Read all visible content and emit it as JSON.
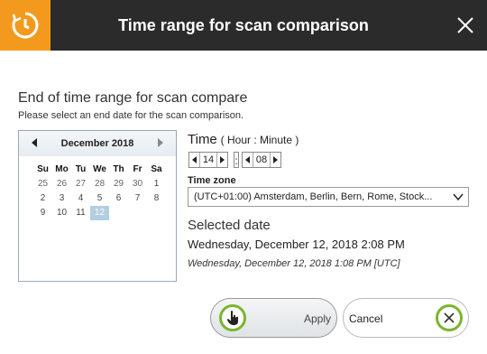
{
  "titlebar": {
    "title": "Time range for scan comparison",
    "accent_color": "#f39a1e",
    "bar_color": "#2b2b2b"
  },
  "content": {
    "heading": "End of time range for scan compare",
    "subheading": "Please select an end date for the scan comparison."
  },
  "calendar": {
    "month_label": "December 2018",
    "weekdays": [
      "Su",
      "Mo",
      "Tu",
      "We",
      "Th",
      "Fr",
      "Sa"
    ],
    "rows": [
      [
        "25",
        "26",
        "27",
        "28",
        "29",
        "30",
        "1"
      ],
      [
        "2",
        "3",
        "4",
        "5",
        "6",
        "7",
        "8"
      ],
      [
        "9",
        "10",
        "11",
        "12",
        "",
        "",
        ""
      ]
    ],
    "selected_day": "12",
    "selected_color": "#b2cfe0"
  },
  "time": {
    "label": "Time",
    "hint": "( Hour : Minute )",
    "hour": "14",
    "minute": "08",
    "separator": ":"
  },
  "timezone": {
    "label": "Time zone",
    "selected": "(UTC+01:00) Amsterdam, Berlin, Bern, Rome, Stock..."
  },
  "selected_date": {
    "label": "Selected date",
    "local": "Wednesday, December 12, 2018 2:08 PM",
    "utc": "Wednesday, December 12, 2018 1:08 PM [UTC]"
  },
  "buttons": {
    "apply_label": "Apply",
    "cancel_label": "Cancel",
    "icon_ring_color": "#7ab52e"
  }
}
